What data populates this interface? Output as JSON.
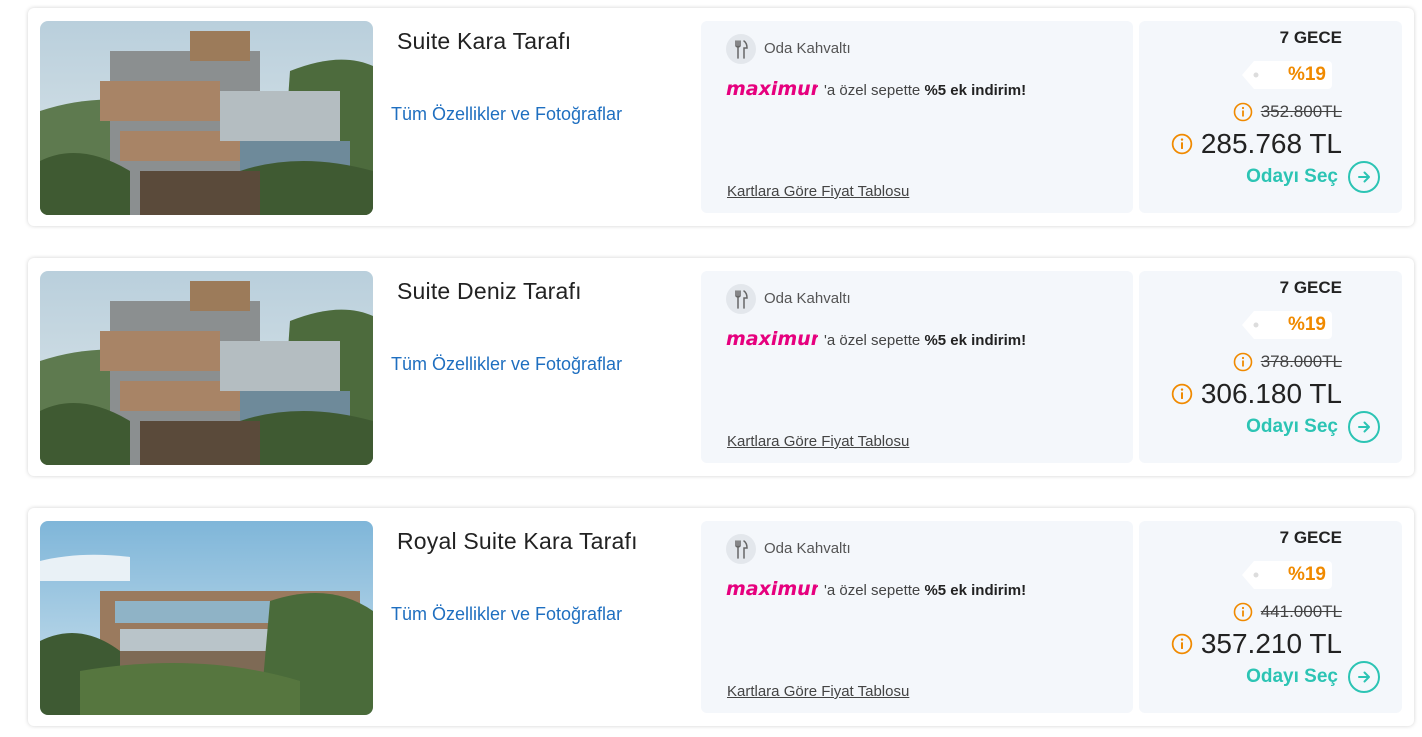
{
  "rooms": [
    {
      "title": "Suite Kara Tarafı",
      "details_link": "Tüm Özellikler ve Fotoğraflar",
      "meal_plan": "Oda Kahvaltı",
      "promo_logo_text": "maximum",
      "promo_prefix": "'a özel sepette ",
      "promo_bold": "%5 ek indirim!",
      "card_table_link": "Kartlara Göre Fiyat Tablosu",
      "nights": "7 GECE",
      "discount": "%19",
      "old_price": "352.800TL",
      "new_price": "285.768 TL",
      "select_label": "Odayı Seç"
    },
    {
      "title": "Suite Deniz Tarafı",
      "details_link": "Tüm Özellikler ve Fotoğraflar",
      "meal_plan": "Oda Kahvaltı",
      "promo_logo_text": "maximum",
      "promo_prefix": "'a özel sepette ",
      "promo_bold": "%5 ek indirim!",
      "card_table_link": "Kartlara Göre Fiyat Tablosu",
      "nights": "7 GECE",
      "discount": "%19",
      "old_price": "378.000TL",
      "new_price": "306.180 TL",
      "select_label": "Odayı Seç"
    },
    {
      "title": "Royal Suite Kara Tarafı",
      "details_link": "Tüm Özellikler ve Fotoğraflar",
      "meal_plan": "Oda Kahvaltı",
      "promo_logo_text": "maximum",
      "promo_prefix": "'a özel sepette ",
      "promo_bold": "%5 ek indirim!",
      "card_table_link": "Kartlara Göre Fiyat Tablosu",
      "nights": "7 GECE",
      "discount": "%19",
      "old_price": "441.000TL",
      "new_price": "357.210 TL",
      "select_label": "Odayı Seç"
    }
  ],
  "icons": {
    "meal": "cutlery-icon",
    "info": "info-icon",
    "select": "arrow-right-circle-icon",
    "discount_tag": "price-tag-icon"
  },
  "colors": {
    "link_blue": "#1f6fc0",
    "accent_teal": "#2cc4b4",
    "discount_orange": "#f08a00",
    "maximum_pink": "#e6007e",
    "panel_bg": "#f4f7fb"
  }
}
